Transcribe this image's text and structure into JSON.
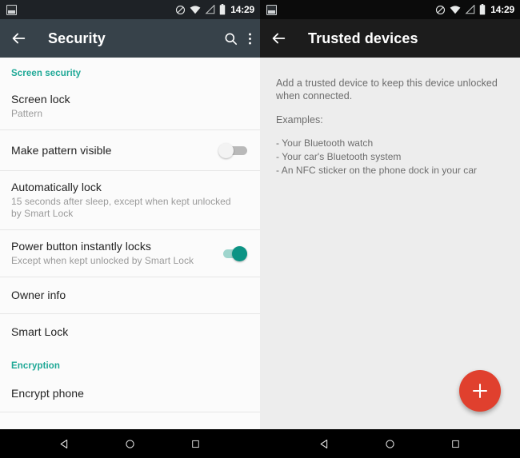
{
  "status_bar": {
    "notification_icon": "screenshot-icon",
    "icons": [
      "do-not-disturb-icon",
      "wifi-icon",
      "cellular-signal-icon",
      "battery-icon"
    ],
    "time": "14:29"
  },
  "left_panel": {
    "toolbar": {
      "back_icon": "back-arrow-icon",
      "title": "Security",
      "search_icon": "search-icon",
      "overflow_icon": "overflow-menu-icon",
      "background_color": "#37424a"
    },
    "sections": [
      {
        "header": "Screen security",
        "header_color": "#1ea896",
        "items": [
          {
            "title": "Screen lock",
            "subtitle": "Pattern",
            "control": "none"
          },
          {
            "title": "Make pattern visible",
            "subtitle": "",
            "control": "switch",
            "switch_state": "off"
          },
          {
            "title": "Automatically lock",
            "subtitle": "15 seconds after sleep, except when kept unlocked by Smart Lock",
            "control": "none"
          },
          {
            "title": "Power button instantly locks",
            "subtitle": "Except when kept unlocked by Smart Lock",
            "control": "switch",
            "switch_state": "on"
          },
          {
            "title": "Owner info",
            "subtitle": "",
            "control": "none"
          },
          {
            "title": "Smart Lock",
            "subtitle": "",
            "control": "none"
          }
        ]
      },
      {
        "header": "Encryption",
        "header_color": "#1ea896",
        "items": [
          {
            "title": "Encrypt phone",
            "subtitle": "",
            "control": "none"
          }
        ]
      }
    ],
    "switch_on_color": "#0c9384",
    "switch_off_color": "#b9b9b9"
  },
  "right_panel": {
    "toolbar": {
      "back_icon": "back-arrow-icon",
      "title": "Trusted devices",
      "background_color": "#1c1c1c"
    },
    "body": {
      "intro": "Add a trusted device to keep this device unlocked when connected.",
      "examples_label": "Examples:",
      "examples": [
        "- Your Bluetooth watch",
        "- Your car's Bluetooth system",
        "- An NFC sticker on the phone dock in your car"
      ]
    },
    "fab": {
      "icon": "plus-icon",
      "color": "#e0402e"
    },
    "background_color": "#ededed"
  },
  "nav_bar": {
    "background_color": "#000000",
    "buttons": [
      "back-triangle-icon",
      "home-circle-icon",
      "recents-square-icon"
    ]
  }
}
